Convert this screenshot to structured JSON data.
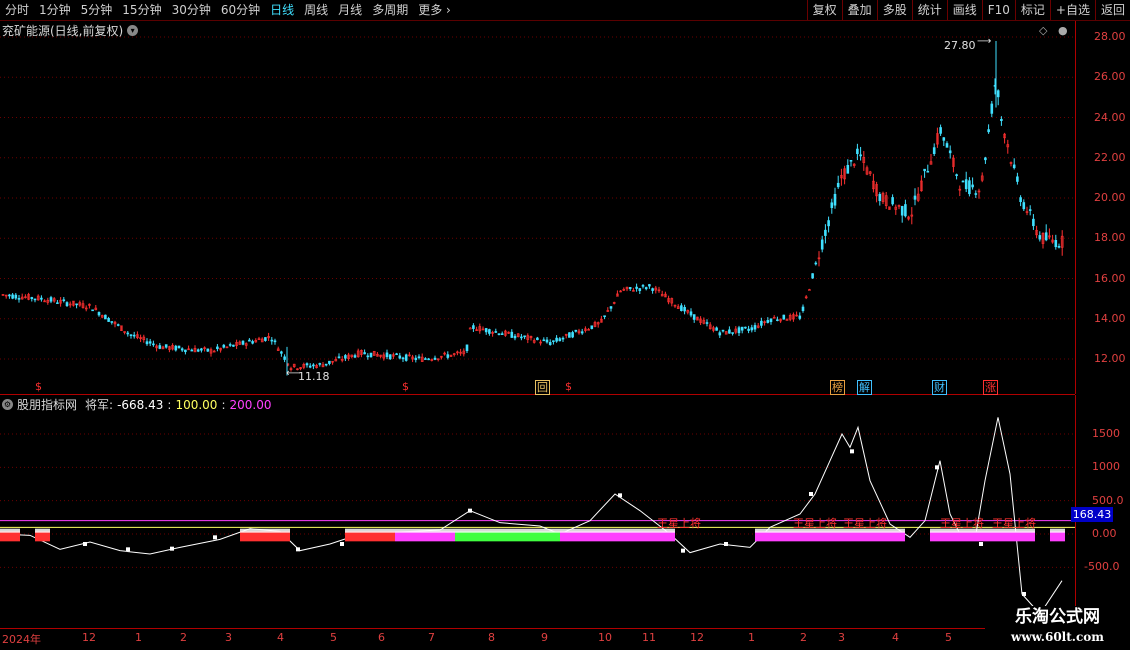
{
  "periods": [
    {
      "label": "分时",
      "active": false
    },
    {
      "label": "1分钟",
      "active": false
    },
    {
      "label": "5分钟",
      "active": false
    },
    {
      "label": "15分钟",
      "active": false
    },
    {
      "label": "30分钟",
      "active": false
    },
    {
      "label": "60分钟",
      "active": false
    },
    {
      "label": "日线",
      "active": true
    },
    {
      "label": "周线",
      "active": false
    },
    {
      "label": "月线",
      "active": false
    },
    {
      "label": "多周期",
      "active": false
    },
    {
      "label": "更多",
      "active": false
    }
  ],
  "tools": [
    "复权",
    "叠加",
    "多股",
    "统计",
    "画线",
    "F10",
    "标记",
    "+自选",
    "返回"
  ],
  "main_title": "兖矿能源(日线,前复权)",
  "price_axis": [
    "28.00",
    "26.00",
    "24.00",
    "22.00",
    "20.00",
    "18.00",
    "16.00",
    "14.00",
    "12.00"
  ],
  "high_label": "27.80",
  "low_label": "11.18",
  "event_markers": [
    {
      "text": "$",
      "color": "#ff3030"
    },
    {
      "text": "$",
      "color": "#ff3030"
    },
    {
      "text": "回",
      "color": "#e8c060"
    },
    {
      "text": "$",
      "color": "#ff3030"
    },
    {
      "text": "榜",
      "color": "#e8a040"
    },
    {
      "text": "解",
      "color": "#40c0ff"
    },
    {
      "text": "财",
      "color": "#40c0ff"
    },
    {
      "text": "涨",
      "color": "#ff3030"
    }
  ],
  "indicator": {
    "title": "股朋指标网",
    "label": "将军: ",
    "value": "-668.43",
    "v1": "100.00",
    "v2": "200.00",
    "axis": [
      "1500",
      "1000",
      "500.0",
      "0.00",
      "-500.0"
    ],
    "current": "168.43",
    "signal_text": "王星上将"
  },
  "dates": [
    "2024年",
    "12",
    "1",
    "2",
    "3",
    "4",
    "5",
    "6",
    "7",
    "8",
    "9",
    "10",
    "11",
    "12",
    "1",
    "2",
    "3",
    "4",
    "5"
  ],
  "watermark": {
    "line1": "乐淘公式网",
    "line2": "www.60lt.com"
  },
  "colors": {
    "up": "#ff3030",
    "down": "#40e0ff",
    "grid": "#8b0000",
    "white": "#ffffff",
    "magenta": "#ff40ff",
    "yellow": "#ffff60",
    "green": "#40ff40"
  }
}
